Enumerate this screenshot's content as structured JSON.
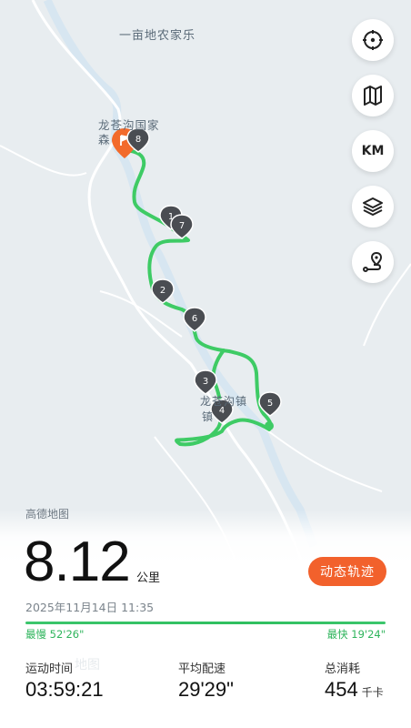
{
  "map": {
    "labels": {
      "top_place": "一亩地农家乐",
      "forest_park_line1": "龙苍沟国家",
      "forest_park_line2": "森",
      "town_line1": "龙苍沟镇",
      "town_line2": "镇"
    },
    "provider": "高德地图",
    "watermark": "地图",
    "route_color": "#3ecb65",
    "start_flag_color": "#f26a2b",
    "km_markers": [
      "1",
      "2",
      "3",
      "4",
      "5",
      "6",
      "7",
      "8"
    ]
  },
  "toolbar": {
    "locate_icon": "locate-icon",
    "map_icon": "map-icon",
    "km_label": "KM",
    "layers_icon": "layers-icon",
    "route_icon": "route-icon"
  },
  "summary": {
    "distance": "8.12",
    "distance_unit": "公里",
    "track_button": "动态轨迹",
    "datetime": "2025年11月14日 11:35",
    "pace_slowest": "最慢 52'26\"",
    "pace_fastest": "最快 19'24\"",
    "accent_color": "#f2612c"
  },
  "stats": [
    {
      "label": "运动时间",
      "value": "03:59:21",
      "unit": ""
    },
    {
      "label": "平均配速",
      "value": "29'29\"",
      "unit": ""
    },
    {
      "label": "总消耗",
      "value": "454",
      "unit": "千卡"
    }
  ]
}
